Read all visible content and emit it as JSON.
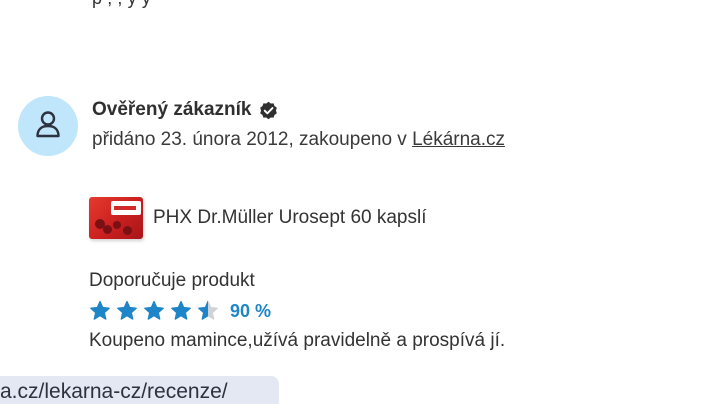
{
  "review": {
    "top_fragment": "p          ,      ,  y        y",
    "reviewer_name": "Ověřený zákazník",
    "meta_prefix": "přidáno 23. února 2012, zakoupeno v ",
    "store_link": "Lékárna.cz",
    "product_name": "PHX Dr.Müller Urosept 60 kapslí",
    "recommend_label": "Doporučuje produkt",
    "rating_value": "90 %",
    "rating_fraction": 0.9,
    "stars_total": 5,
    "text": "Koupeno mamince,užívá pravidelně a prospívá jí."
  },
  "status_bar": {
    "url": "a.cz/lekarna-cz/recenze/"
  },
  "colors": {
    "avatar_bg": "#bfe6fb",
    "star_fill": "#1e86c8",
    "star_empty": "#d0d4d8",
    "rating_text": "#1e86c8",
    "tooltip_bg": "#e3e8f3"
  },
  "icons": {
    "avatar": "user-icon",
    "verified": "check-badge-icon",
    "star": "star-icon"
  }
}
